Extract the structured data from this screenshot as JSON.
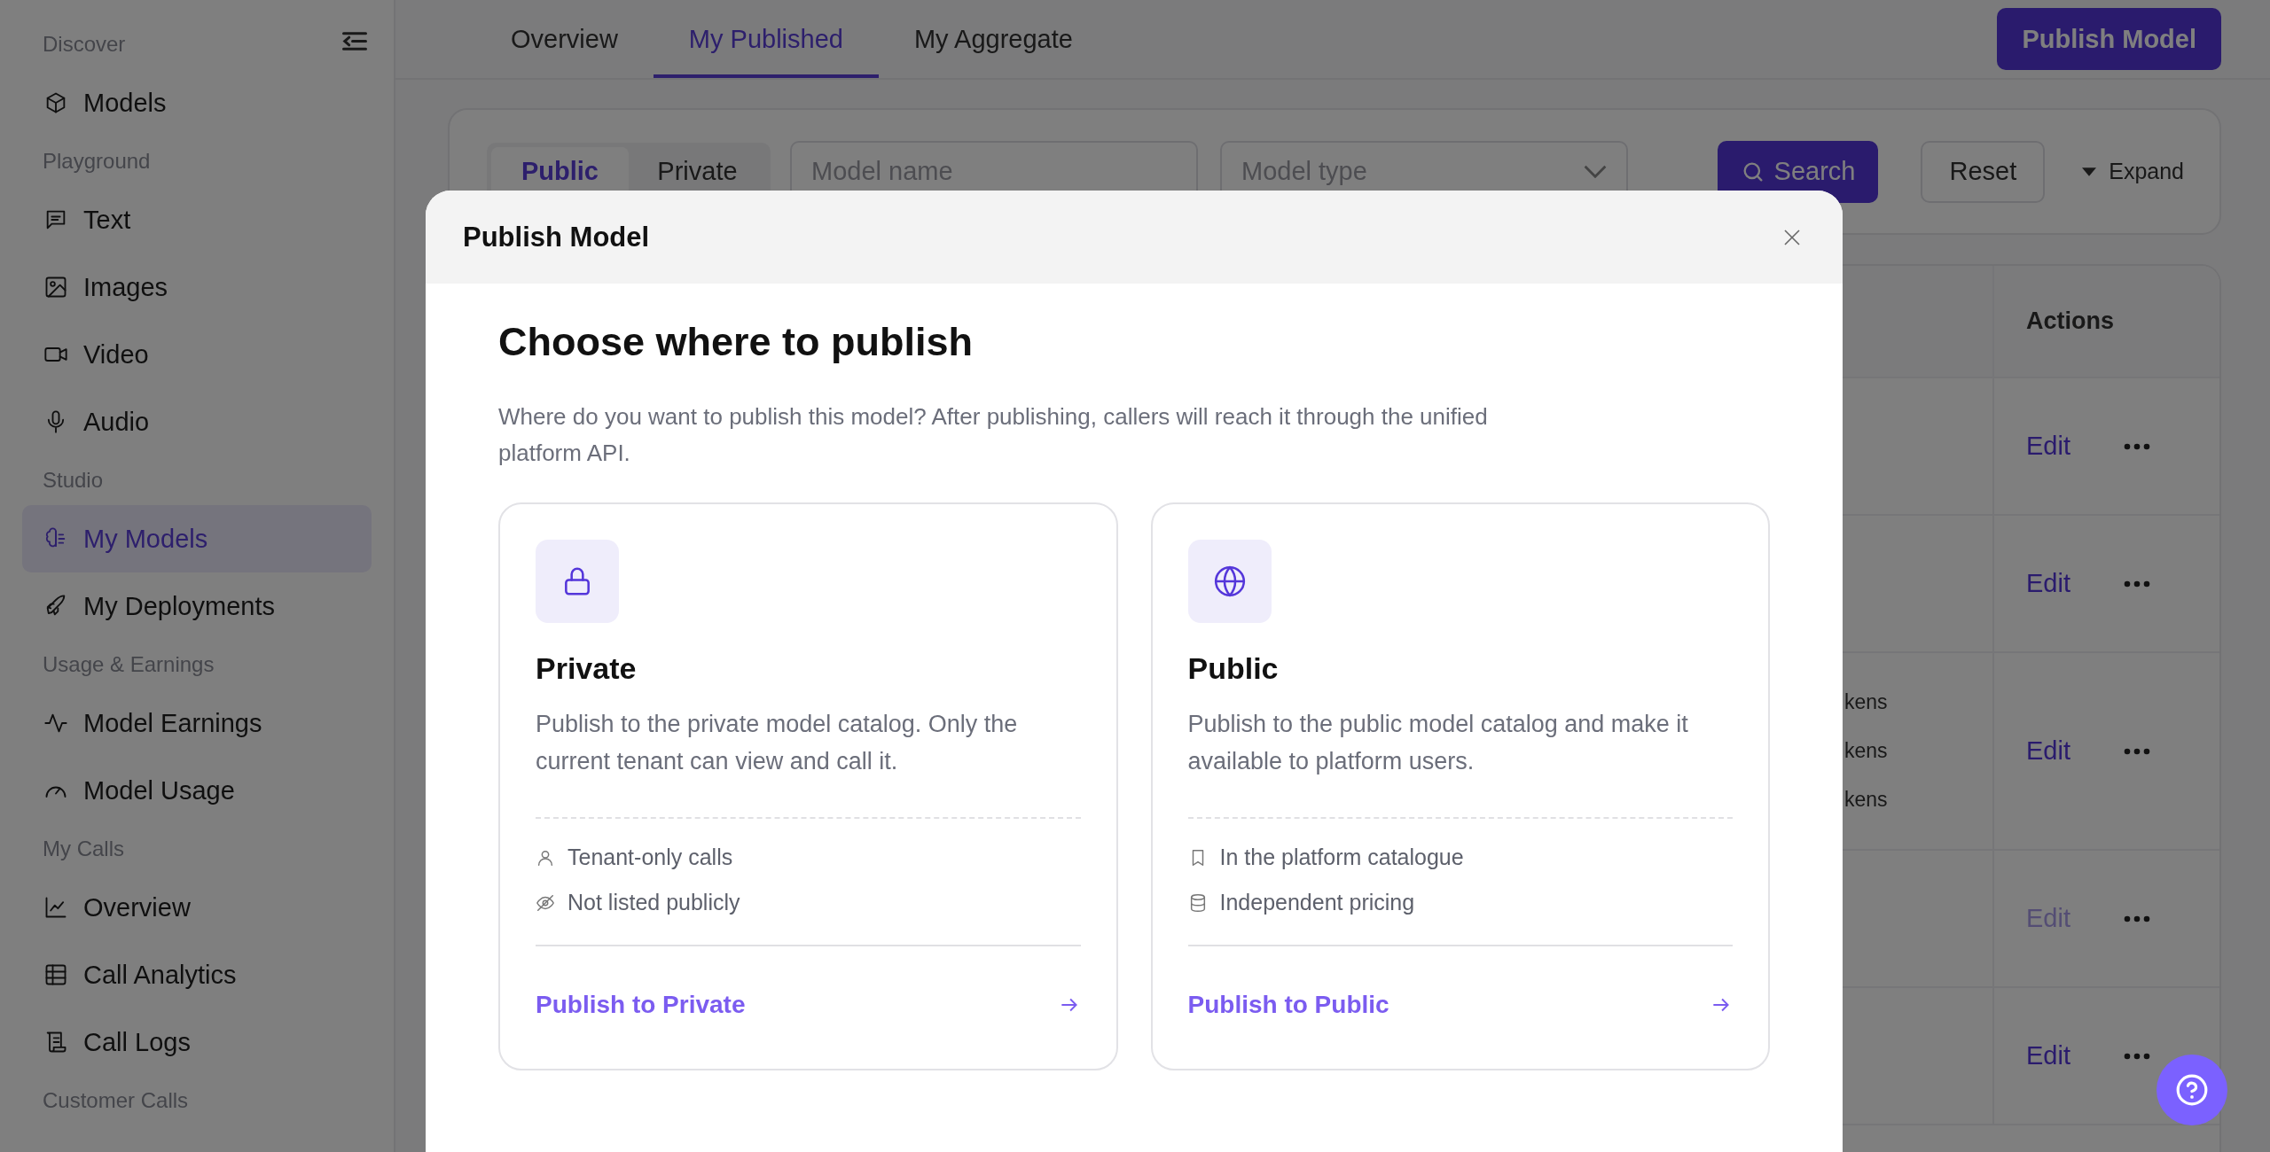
{
  "sidebar": {
    "sections": [
      {
        "heading": "Discover",
        "items": [
          {
            "label": "Models",
            "selected": false
          }
        ]
      },
      {
        "heading": "Playground",
        "items": [
          {
            "label": "Text",
            "selected": false
          },
          {
            "label": "Images",
            "selected": false
          },
          {
            "label": "Video",
            "selected": false
          },
          {
            "label": "Audio",
            "selected": false
          }
        ]
      },
      {
        "heading": "Studio",
        "items": [
          {
            "label": "My Models",
            "selected": true
          },
          {
            "label": "My Deployments",
            "selected": false
          }
        ]
      },
      {
        "heading": "Usage & Earnings",
        "items": [
          {
            "label": "Model Earnings",
            "selected": false
          },
          {
            "label": "Model Usage",
            "selected": false
          }
        ]
      },
      {
        "heading": "My Calls",
        "items": [
          {
            "label": "Overview",
            "selected": false
          },
          {
            "label": "Call Analytics",
            "selected": false
          },
          {
            "label": "Call Logs",
            "selected": false
          }
        ]
      },
      {
        "heading": "Customer Calls"
      }
    ]
  },
  "tabs": [
    {
      "label": "Overview",
      "selected": false
    },
    {
      "label": "My Published",
      "selected": true
    },
    {
      "label": "My Aggregate",
      "selected": false
    }
  ],
  "publish_button": "Publish Model",
  "filter": {
    "scope": [
      {
        "label": "Public",
        "selected": true
      },
      {
        "label": "Private",
        "selected": false
      }
    ],
    "model_name": {
      "placeholder": "Model name"
    },
    "model_type": {
      "placeholder": "Model type"
    },
    "search_button": "Search",
    "reset_button": "Reset",
    "expand_link": "Expand"
  },
  "table": {
    "actions_header": "Actions",
    "rows": [
      {
        "column_2": [],
        "edit": {
          "label": "Edit",
          "disabled": false
        }
      },
      {
        "column_2": [],
        "edit": {
          "label": "Edit",
          "disabled": false
        }
      },
      {
        "column_2": [
          "kens",
          "kens",
          "kens"
        ],
        "edit": {
          "label": "Edit",
          "disabled": false
        }
      },
      {
        "column_2": [],
        "edit": {
          "label": "Edit",
          "disabled": true
        }
      },
      {
        "column_2": [],
        "edit": {
          "label": "Edit",
          "disabled": false
        }
      }
    ]
  },
  "modal": {
    "title": "Publish Model",
    "heading": "Choose where to publish",
    "description": "Where do you want to publish this model? After publishing, callers will reach it through the unified platform API.",
    "options": [
      {
        "title": "Private",
        "description": "Publish to the private model catalog. Only the current tenant can view and call it.",
        "features": [
          "Tenant-only calls",
          "Not listed publicly"
        ],
        "action": "Publish to Private"
      },
      {
        "title": "Public",
        "description": "Publish to the public model catalog and make it available to platform users.",
        "features": [
          "In the platform catalogue",
          "Independent pricing"
        ],
        "action": "Publish to Public"
      }
    ]
  }
}
